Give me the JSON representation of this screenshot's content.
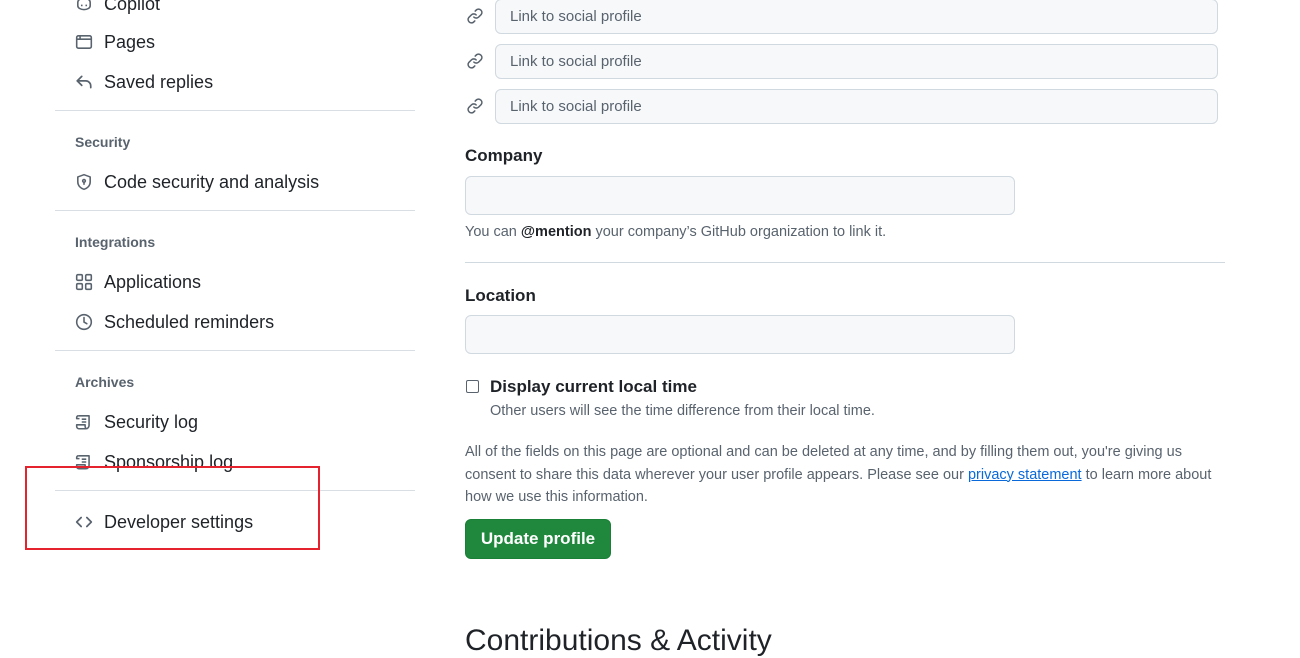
{
  "sidebar": {
    "items": {
      "copilot": {
        "label": "Copilot",
        "icon": "copilot-icon"
      },
      "pages": {
        "label": "Pages",
        "icon": "browser-icon"
      },
      "saved_replies": {
        "label": "Saved replies",
        "icon": "reply-icon"
      },
      "code_security": {
        "label": "Code security and analysis",
        "icon": "shield-icon"
      },
      "applications": {
        "label": "Applications",
        "icon": "apps-icon"
      },
      "scheduled_reminders": {
        "label": "Scheduled reminders",
        "icon": "clock-icon"
      },
      "security_log": {
        "label": "Security log",
        "icon": "log-icon"
      },
      "sponsorship_log": {
        "label": "Sponsorship log",
        "icon": "log-icon"
      },
      "developer_settings": {
        "label": "Developer settings",
        "icon": "code-icon"
      }
    },
    "groups": {
      "security": "Security",
      "integrations": "Integrations",
      "archives": "Archives"
    },
    "highlight_color": "#e5232f"
  },
  "main": {
    "social_placeholder": "Link to social profile",
    "company": {
      "label": "Company",
      "value": "",
      "note_prefix": "You can ",
      "note_bold": "@mention",
      "note_suffix": " your company’s GitHub organization to link it."
    },
    "location": {
      "label": "Location",
      "value": ""
    },
    "local_time": {
      "label": "Display current local time",
      "hint": "Other users will see the time difference from their local time.",
      "checked": false
    },
    "disclaimer": {
      "before": "All of the fields on this page are optional and can be deleted at any time, and by filling them out, you're giving us consent to share this data wherever your user profile appears. Please see our ",
      "link": "privacy statement",
      "after": " to learn more about how we use this information."
    },
    "update_button": "Update profile",
    "next_section_title": "Contributions & Activity"
  },
  "colors": {
    "primary_button": "#1f883d",
    "link": "#0969da",
    "muted_text": "#59636e",
    "input_bg": "#f6f8fa"
  }
}
